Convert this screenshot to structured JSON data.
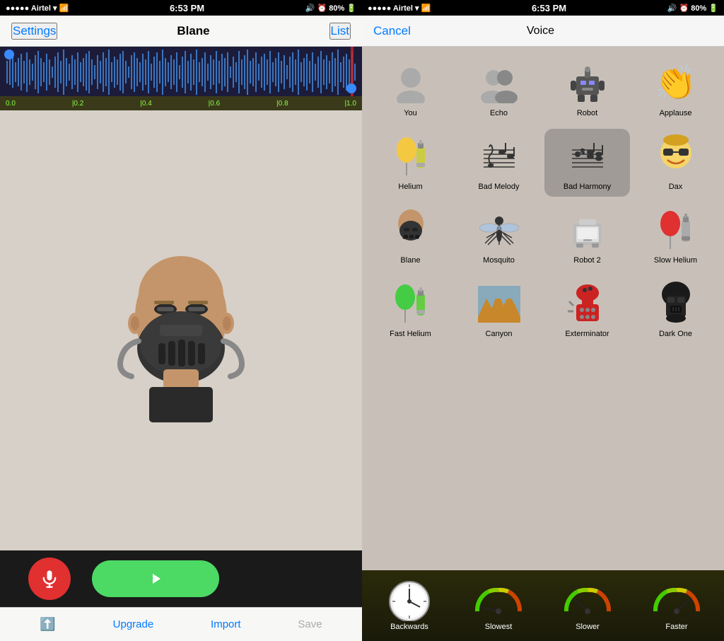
{
  "left": {
    "status": {
      "signal": "●●●●● Airtel",
      "wifi": "WiFi",
      "time": "6:53 PM",
      "battery_icon": "📶",
      "battery": "80%"
    },
    "nav": {
      "settings_label": "Settings",
      "title": "Blane",
      "list_label": "List"
    },
    "waveform": {
      "timeline": [
        "0.0",
        "|0.2",
        "|0.4",
        "|0.6",
        "|0.8",
        "|1.0"
      ]
    },
    "bottom": {
      "upgrade_label": "Upgrade",
      "import_label": "Import",
      "save_label": "Save"
    }
  },
  "right": {
    "status": {
      "signal": "●●●●● Airtel",
      "time": "6:53 PM",
      "battery": "80%"
    },
    "nav": {
      "cancel_label": "Cancel",
      "title": "Voice"
    },
    "voices": [
      {
        "id": "you",
        "label": "You",
        "emoji": "👤"
      },
      {
        "id": "echo",
        "label": "Echo",
        "emoji": "👥"
      },
      {
        "id": "robot",
        "label": "Robot",
        "emoji": "🤖"
      },
      {
        "id": "applause",
        "label": "Applause",
        "emoji": "👏"
      },
      {
        "id": "helium",
        "label": "Helium",
        "emoji": "🎈"
      },
      {
        "id": "bad-melody",
        "label": "Bad Melody",
        "emoji": "🎵"
      },
      {
        "id": "bad-harmony",
        "label": "Bad Harmony",
        "emoji": "🎼"
      },
      {
        "id": "dax",
        "label": "Dax",
        "emoji": "😎"
      },
      {
        "id": "blane",
        "label": "Blane",
        "emoji": "🦹"
      },
      {
        "id": "mosquito",
        "label": "Mosquito",
        "emoji": "🦟"
      },
      {
        "id": "robot2",
        "label": "Robot 2",
        "emoji": "🖨️"
      },
      {
        "id": "slow-helium",
        "label": "Slow Helium",
        "emoji": "🎈"
      },
      {
        "id": "fast-helium",
        "label": "Fast Helium",
        "emoji": "🟢"
      },
      {
        "id": "canyon",
        "label": "Canyon",
        "emoji": "🏔️"
      },
      {
        "id": "exterminator",
        "label": "Exterminator",
        "emoji": "🔴"
      },
      {
        "id": "dark-one",
        "label": "Dark One",
        "emoji": "🌑"
      }
    ],
    "speeds": [
      {
        "id": "backwards",
        "label": "Backwards"
      },
      {
        "id": "slowest",
        "label": "Slowest"
      },
      {
        "id": "slower",
        "label": "Slower"
      },
      {
        "id": "faster",
        "label": "Faster"
      }
    ]
  }
}
